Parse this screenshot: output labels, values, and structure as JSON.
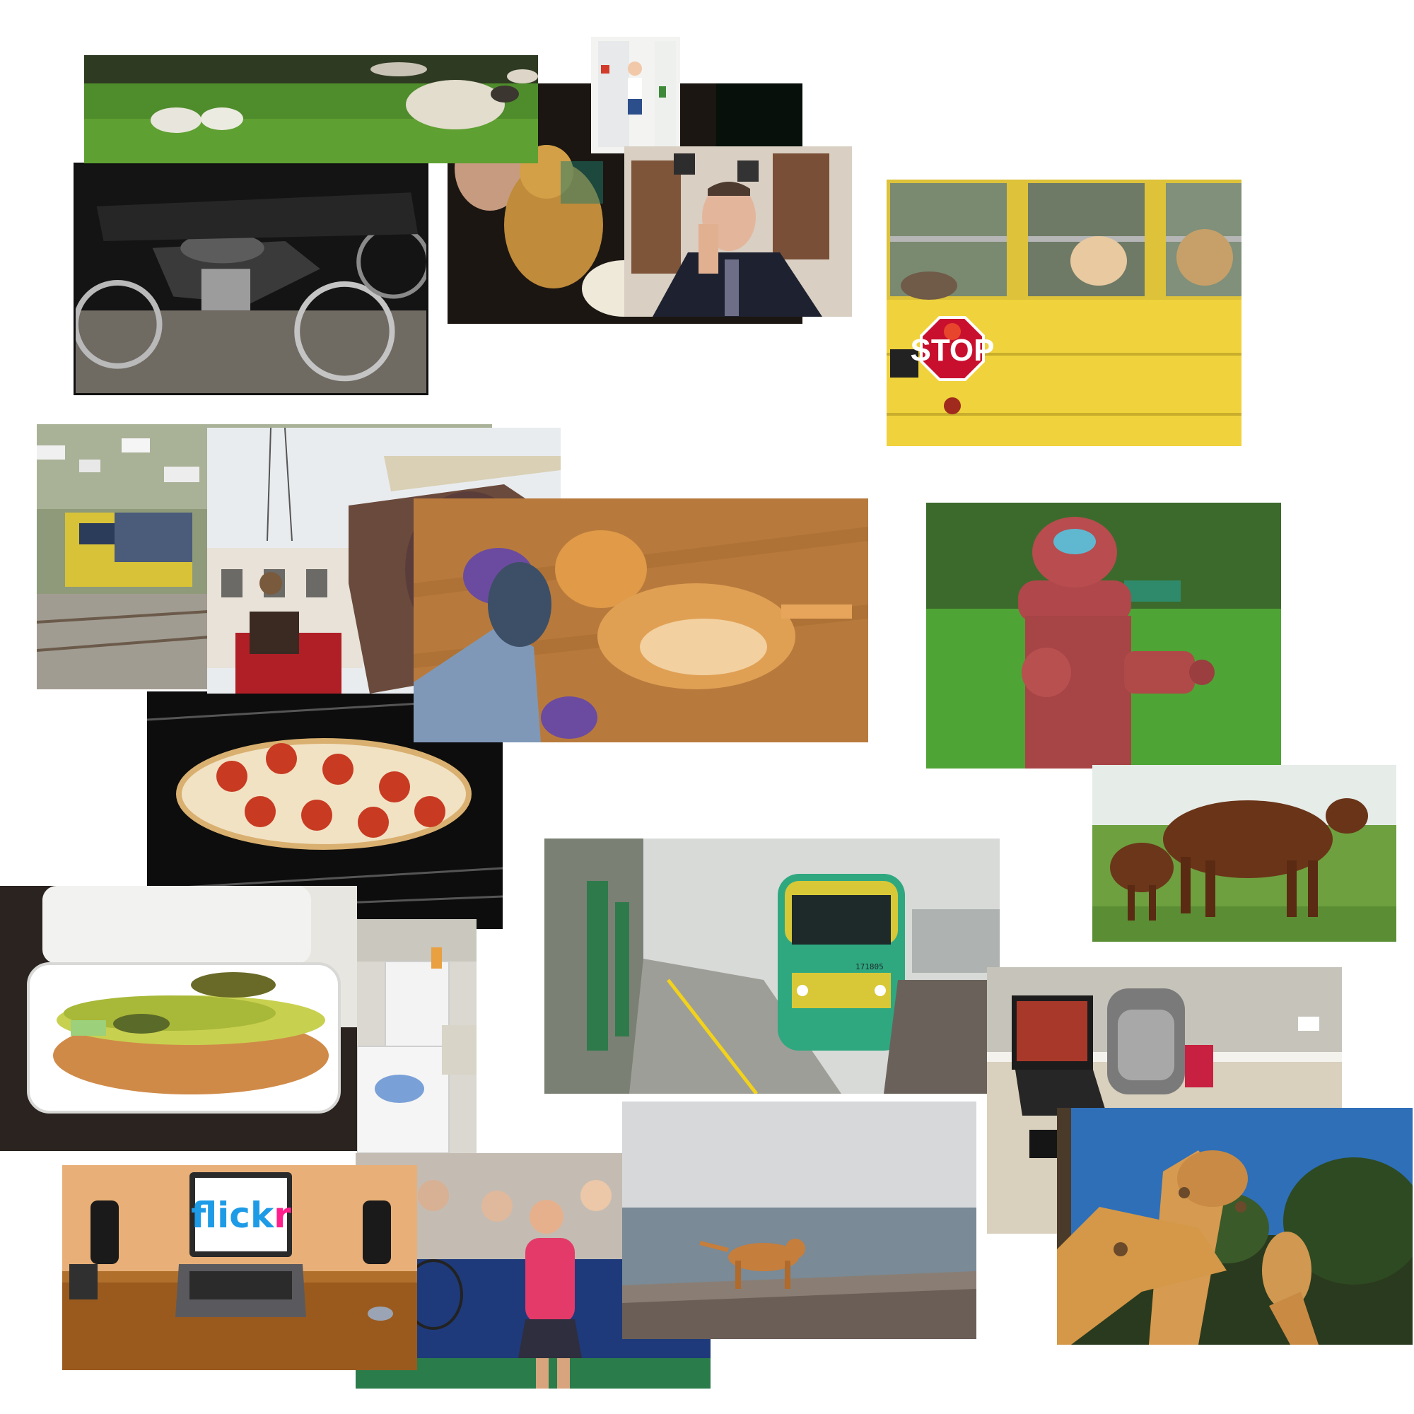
{
  "collage": {
    "photos": [
      {
        "id": "sheep",
        "subject": "sheep grazing on grass"
      },
      {
        "id": "motorcycle",
        "subject": "parked vintage motorcycles"
      },
      {
        "id": "teddy-bear",
        "subject": "stuffed teddy bear"
      },
      {
        "id": "fridge",
        "subject": "child standing inside a refrigerator"
      },
      {
        "id": "man",
        "subject": "man in suit leaning head on hand"
      },
      {
        "id": "school-bus",
        "subject": "dogs in a yellow school bus with stop sign"
      },
      {
        "id": "train-tracks",
        "subject": "trains on tracks below a hillside town"
      },
      {
        "id": "mechanical-elephant",
        "subject": "giant mechanical elephant in a street"
      },
      {
        "id": "cat",
        "subject": "orange cat lying on wooden floor by a foot"
      },
      {
        "id": "fire-hydrant",
        "subject": "red fire hydrant in grass"
      },
      {
        "id": "pizza",
        "subject": "pepperoni pizza on oven rack"
      },
      {
        "id": "cows",
        "subject": "brown cow and calf in a field"
      },
      {
        "id": "hot-dog",
        "subject": "hot dog with pickle in takeaway box"
      },
      {
        "id": "laundry",
        "subject": "laundry room with appliances"
      },
      {
        "id": "station-train",
        "subject": "green and yellow train at a platform"
      },
      {
        "id": "laptop-bag",
        "subject": "laptop and backpack on carpet"
      },
      {
        "id": "giraffes",
        "subject": "giraffes eating leaves"
      },
      {
        "id": "flickr-laptop",
        "subject": "laptop on desk with speakers"
      },
      {
        "id": "tennis",
        "subject": "tennis player holding racket"
      },
      {
        "id": "dog",
        "subject": "dog stretching on a sea wall"
      }
    ]
  },
  "texts": {
    "stop_sign": "STOP",
    "flickr_blue": "flick",
    "flickr_pink": "r",
    "train_number": "171805"
  },
  "colors": {
    "flickr_blue": "#1e9be6",
    "flickr_pink": "#ff1e8c",
    "stop_red": "#c8102e",
    "bus_yellow": "#f0d23c"
  }
}
